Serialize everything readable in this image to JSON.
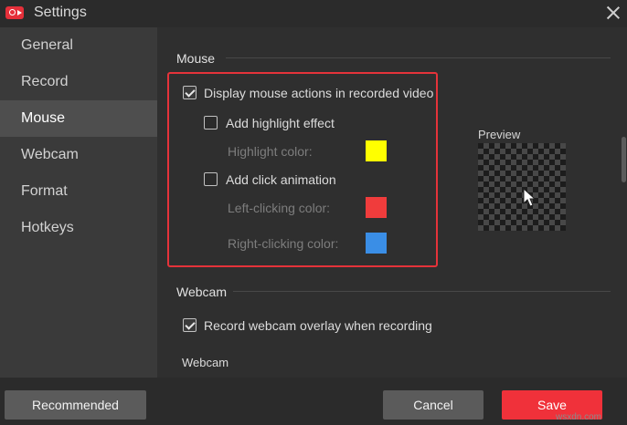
{
  "window": {
    "title": "Settings"
  },
  "sidebar": {
    "items": [
      {
        "label": "General"
      },
      {
        "label": "Record"
      },
      {
        "label": "Mouse"
      },
      {
        "label": "Webcam"
      },
      {
        "label": "Format"
      },
      {
        "label": "Hotkeys"
      }
    ],
    "active": "Mouse"
  },
  "mouse": {
    "section_title": "Mouse",
    "display_actions": {
      "label": "Display mouse actions in recorded video",
      "checked": true
    },
    "highlight": {
      "label": "Add highlight effect",
      "checked": false,
      "color_label": "Highlight color:",
      "color": "#ffff00"
    },
    "click_animation": {
      "label": "Add click animation",
      "checked": false,
      "left_label": "Left-clicking color:",
      "left_color": "#f03c3c",
      "right_label": "Right-clicking color:",
      "right_color": "#3a8ee6"
    },
    "preview_label": "Preview"
  },
  "webcam": {
    "section_title": "Webcam",
    "overlay": {
      "label": "Record webcam overlay when recording",
      "checked": true
    },
    "sub_label": "Webcam"
  },
  "footer": {
    "recommended": "Recommended",
    "cancel": "Cancel",
    "save": "Save"
  },
  "watermark": "wsxdn.com",
  "colors": {
    "accent": "#f0313a",
    "highlight_box": "#e5333a"
  }
}
